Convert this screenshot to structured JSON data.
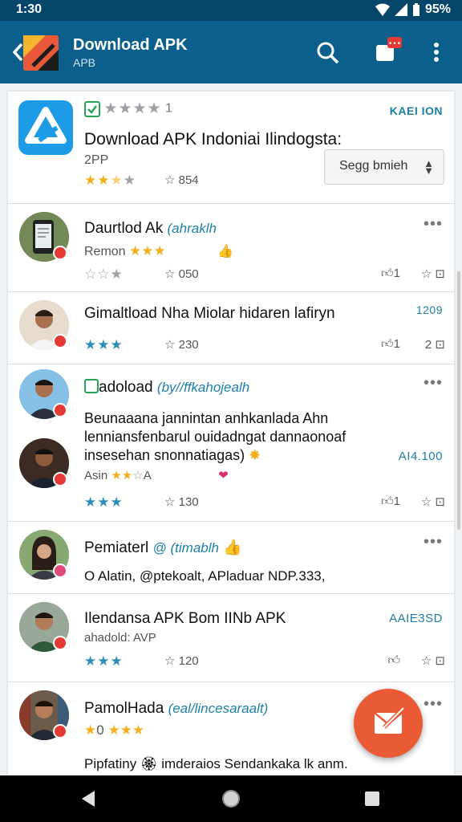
{
  "status_bar": {
    "time": "1:30",
    "battery": "95%"
  },
  "app_bar": {
    "title": "Download APK",
    "subtitle": "APB",
    "icons": [
      "back-arrow-icon",
      "app-logo",
      "search-icon",
      "notification-icon",
      "overflow-menu-icon"
    ]
  },
  "header_item": {
    "verified_rating": "1",
    "tag": "KAEI ION",
    "title": "Download APK  Indoniai Ilindogsta:",
    "subtitle": "2PP",
    "count": "854",
    "sort_label": "Segg bmieh"
  },
  "items": [
    {
      "name": "Daurtlod Ak",
      "handle": "(ahraklh",
      "meta": "Remon",
      "count": "050",
      "act1": "1",
      "act2": "",
      "act3": ""
    },
    {
      "name": "Gimaltload Nha Miolar hidaren lafiryn",
      "tag": "1209",
      "count": "230",
      "act1": "1",
      "act2": "2",
      "act3": ""
    },
    {
      "name": "adoload",
      "handle": "(by//ffkahojealh",
      "body_lines": [
        "Beunaaana jannintan anhkanlada Ahn",
        "lenniansfenbarul ouidadngat dannaonoaf",
        "insesehan snonnatiagas)"
      ],
      "tag": "AI4.100",
      "meta": "Asin",
      "count": "130",
      "act1": "1",
      "act2": "",
      "act3": ""
    },
    {
      "name": "Pemiaterl",
      "handle": "@ (timablh",
      "body": "O Alatin, @ptekoalt, APladuar NDP.333,",
      "verified": true
    },
    {
      "name": "Ilendansa APK Bom IINb APK",
      "tag": "AAIE3SD",
      "meta": "ahadold: AVP",
      "count": "120"
    },
    {
      "name": "PamolHada",
      "handle": "(eal/lincesaraalt)",
      "rating": "0",
      "body": "Pipfatiny 🏵 imderaios Sendankaka lk anm."
    }
  ],
  "nav_bar": {
    "icons": [
      "nav-back-icon",
      "nav-home-icon",
      "nav-recents-icon"
    ]
  },
  "colors": {
    "primary": "#0a5f8c",
    "status": "#07466b",
    "accent": "#ea5a35",
    "link": "#1d7fa6",
    "star": "#f2b01e"
  }
}
